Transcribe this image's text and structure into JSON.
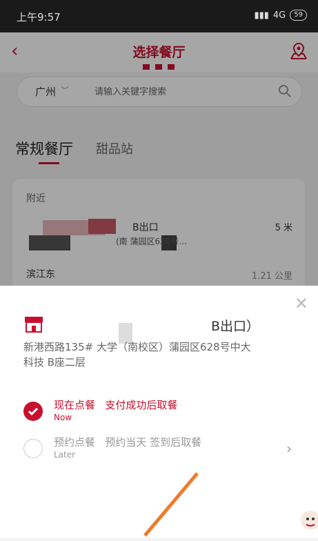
{
  "status_bar": {
    "time": "上午9:57",
    "signal": "4G",
    "battery": "59"
  },
  "header": {
    "title": "选择餐厅"
  },
  "search": {
    "city": "广州",
    "placeholder": "请输入关键字搜索"
  },
  "tabs": {
    "active": "常规餐厅",
    "other": "甜品站"
  },
  "nearby": {
    "label": "附近",
    "items": [
      {
        "name": "B出口",
        "address": "(南       蒲园区628号...",
        "distance": "5 米"
      },
      {
        "name": "滨江东",
        "distance": "1.21 公里"
      }
    ]
  },
  "sheet": {
    "store_name": "B出口）",
    "store_address": "新港西路135#       大学（南校区）蒲园区628号中大科技       B座二层",
    "options": [
      {
        "main": "现在点餐",
        "desc": "支付成功后取餐",
        "sub": "Now"
      },
      {
        "main": "预约点餐",
        "desc": "预约当天 签到后取餐",
        "sub": "Later"
      }
    ]
  },
  "colors": {
    "accent": "#c8102e"
  }
}
